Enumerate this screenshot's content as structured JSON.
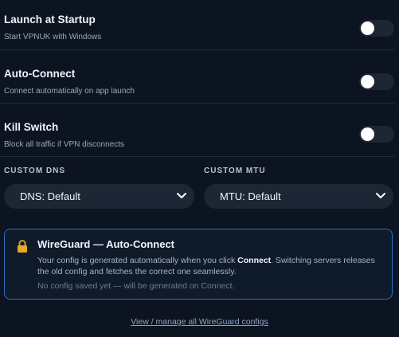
{
  "settings": [
    {
      "title": "Launch at Startup",
      "subtitle": "Start VPNUK with Windows",
      "enabled": false
    },
    {
      "title": "Auto-Connect",
      "subtitle": "Connect automatically on app launch",
      "enabled": false
    },
    {
      "title": "Kill Switch",
      "subtitle": "Block all traffic if VPN disconnects",
      "enabled": false
    }
  ],
  "dns": {
    "label": "CUSTOM DNS",
    "value": "DNS: Default"
  },
  "mtu": {
    "label": "CUSTOM MTU",
    "value": "MTU: Default"
  },
  "wireguard": {
    "title": "WireGuard — Auto-Connect",
    "body_prefix": "Your config is generated automatically when you click ",
    "body_emphasis": "Connect",
    "body_suffix": ". Switching servers releases the old config and fetches the correct one seamlessly.",
    "note": "No config saved yet — will be generated on Connect."
  },
  "footer": {
    "link": "View / manage all WireGuard configs"
  },
  "colors": {
    "background": "#0d1421",
    "accent_border": "#2f6fc4",
    "lock_icon": "#e9a825",
    "toggle_track": "#1d2635"
  }
}
